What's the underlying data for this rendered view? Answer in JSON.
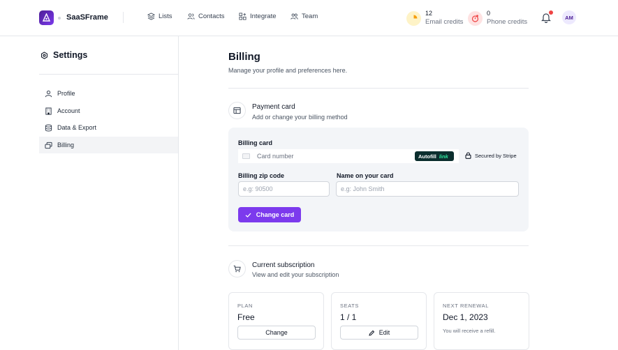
{
  "app": {
    "name": "SaaSFrame"
  },
  "nav": {
    "items": [
      {
        "label": "Lists",
        "icon": "layers-icon"
      },
      {
        "label": "Contacts",
        "icon": "users-icon"
      },
      {
        "label": "Integrate",
        "icon": "plug-grid-icon"
      },
      {
        "label": "Team",
        "icon": "team-icon"
      }
    ]
  },
  "credits": {
    "email": {
      "count": "12",
      "label": "Email credits",
      "color": "#f59e0b"
    },
    "phone": {
      "count": "0",
      "label": "Phone credits",
      "color": "#ef4444"
    }
  },
  "user": {
    "initials": "AM",
    "has_notification": true
  },
  "sidebar": {
    "title": "Settings",
    "items": [
      {
        "label": "Profile",
        "icon": "user-icon"
      },
      {
        "label": "Account",
        "icon": "building-icon"
      },
      {
        "label": "Data & Export",
        "icon": "database-icon"
      },
      {
        "label": "Billing",
        "icon": "cards-icon",
        "active": true
      }
    ]
  },
  "page": {
    "title": "Billing",
    "subtitle": "Manage your profile and preferences here."
  },
  "payment": {
    "title": "Payment card",
    "subtitle": "Add or change your billing method",
    "billing_card_label": "Billing card",
    "card_placeholder": "Card number",
    "autofill_label": "Autofill",
    "autofill_brand": "link",
    "secured_text": "Secured by Stripe",
    "zip_label": "Billing zip code",
    "zip_placeholder": "e.g: 90500",
    "name_label": "Name on your card",
    "name_placeholder": "e.g: John Smith",
    "change_button": "Change card"
  },
  "subscription": {
    "title": "Current subscription",
    "subtitle": "View and edit your subscription",
    "plan": {
      "caption": "PLAN",
      "value": "Free",
      "button": "Change"
    },
    "seats": {
      "caption": "SEATS",
      "value": "1 / 1",
      "button": "Edit"
    },
    "renewal": {
      "caption": "NEXT RENEWAL",
      "value": "Dec 1, 2023",
      "note": "You will receive a refill."
    }
  },
  "colors": {
    "accent": "#7c3aed",
    "brand_dark": "#4c1d95",
    "muted_bg": "#f3f5f8"
  }
}
